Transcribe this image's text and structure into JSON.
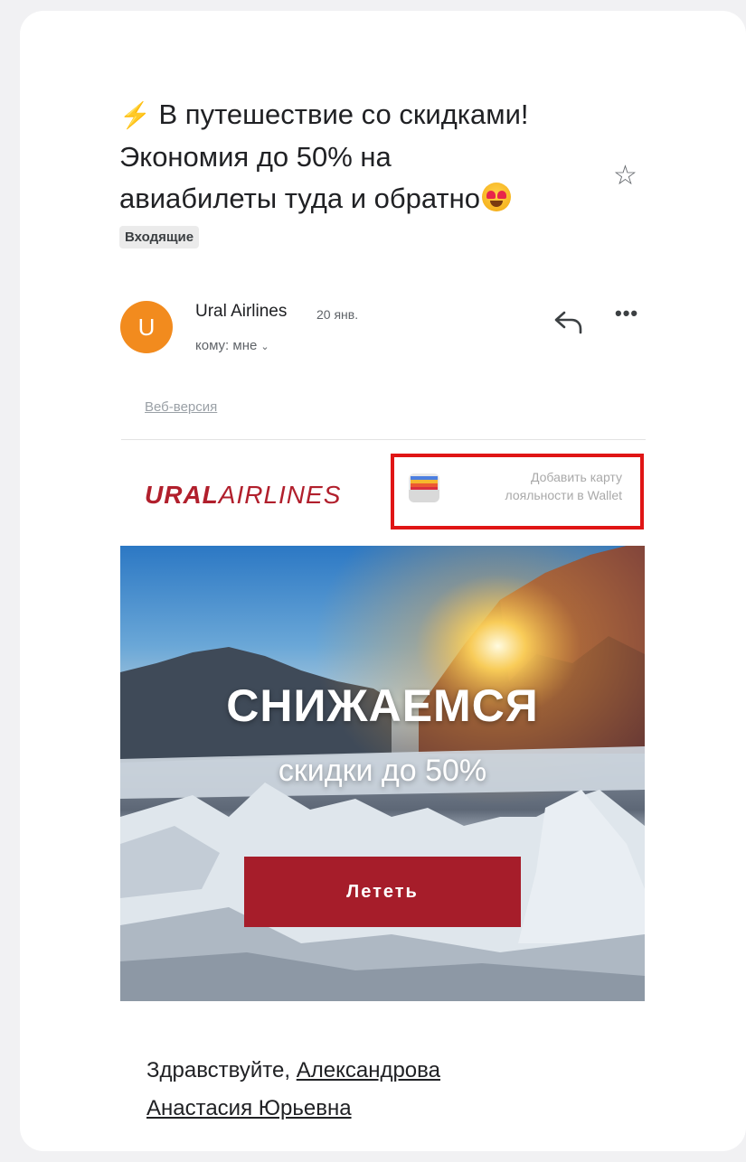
{
  "email": {
    "subject_prefix_icon": "lightning-bolt-emoji",
    "subject_line1": "В путешествие со скидками!",
    "subject_line2": "Экономия до 50% на",
    "subject_line3": "авиабилеты туда и обратно",
    "subject_suffix_icon": "heart-eyes-emoji",
    "label": "Входящие",
    "sender": {
      "avatar_letter": "U",
      "name": "Ural Airlines",
      "date": "20 янв.",
      "recipient": "кому: мне"
    },
    "web_version_link": "Веб-версия"
  },
  "promo": {
    "logo_bold": "URAL",
    "logo_light": "AIRLINES",
    "wallet_line1": "Добавить карту",
    "wallet_line2": "лояльности в Wallet",
    "hero_title": "СНИЖАЕМСЯ",
    "hero_subtitle": "скидки до 50%",
    "cta_label": "Лететь",
    "greeting_prefix": "Здравствуйте,",
    "greeting_name_line1": "Александрова",
    "greeting_name_line2": "Анастасия Юрьевна"
  },
  "colors": {
    "brand_red": "#b11f2c",
    "cta_red": "#a61d2a",
    "highlight_border": "#e01515",
    "avatar_orange": "#f28b1e"
  },
  "icons": {
    "star": "star-icon",
    "reply": "reply-icon",
    "more": "more-horizontal-icon",
    "wallet": "wallet-icon"
  }
}
